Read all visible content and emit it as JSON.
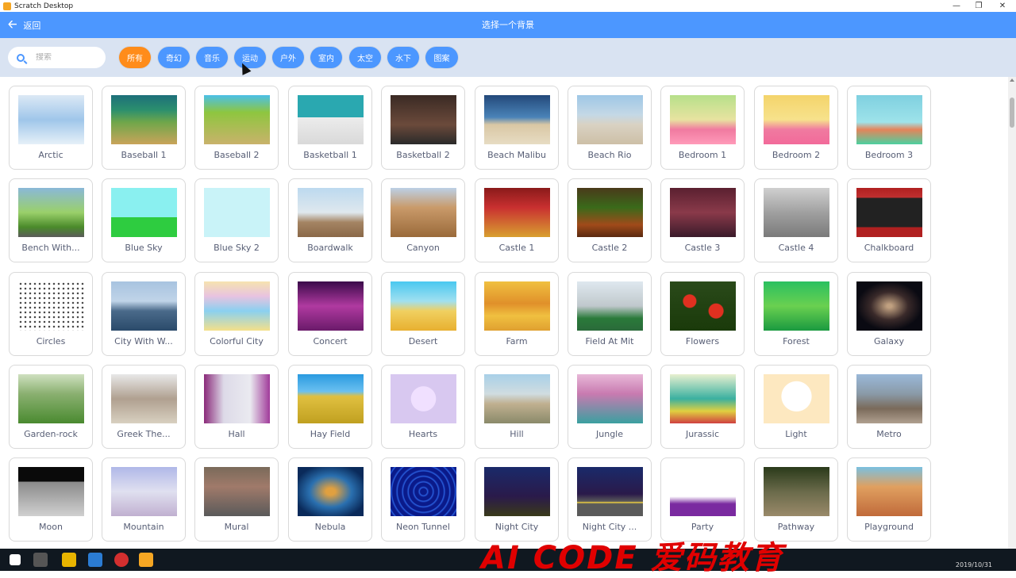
{
  "window": {
    "title": "Scratch Desktop"
  },
  "header": {
    "back_label": "返回",
    "title": "选择一个背景"
  },
  "search": {
    "placeholder": "搜索"
  },
  "tags": [
    "所有",
    "奇幻",
    "音乐",
    "运动",
    "户外",
    "室内",
    "太空",
    "水下",
    "图案"
  ],
  "active_tag": "所有",
  "colors": {
    "header": "#4c97ff",
    "active_tag": "#ff8c1a",
    "tag": "#4c97ff",
    "filterbar": "#d9e3f2"
  },
  "backdrops": [
    {
      "name": "Arctic"
    },
    {
      "name": "Baseball 1"
    },
    {
      "name": "Baseball 2"
    },
    {
      "name": "Basketball 1"
    },
    {
      "name": "Basketball 2"
    },
    {
      "name": "Beach Malibu"
    },
    {
      "name": "Beach Rio"
    },
    {
      "name": "Bedroom 1"
    },
    {
      "name": "Bedroom 2"
    },
    {
      "name": "Bedroom 3"
    },
    {
      "name": "Bench With..."
    },
    {
      "name": "Blue Sky"
    },
    {
      "name": "Blue Sky 2"
    },
    {
      "name": "Boardwalk"
    },
    {
      "name": "Canyon"
    },
    {
      "name": "Castle 1"
    },
    {
      "name": "Castle 2"
    },
    {
      "name": "Castle 3"
    },
    {
      "name": "Castle 4"
    },
    {
      "name": "Chalkboard"
    },
    {
      "name": "Circles"
    },
    {
      "name": "City With W..."
    },
    {
      "name": "Colorful City"
    },
    {
      "name": "Concert"
    },
    {
      "name": "Desert"
    },
    {
      "name": "Farm"
    },
    {
      "name": "Field At Mit"
    },
    {
      "name": "Flowers"
    },
    {
      "name": "Forest"
    },
    {
      "name": "Galaxy"
    },
    {
      "name": "Garden-rock"
    },
    {
      "name": "Greek The..."
    },
    {
      "name": "Hall"
    },
    {
      "name": "Hay Field"
    },
    {
      "name": "Hearts"
    },
    {
      "name": "Hill"
    },
    {
      "name": "Jungle"
    },
    {
      "name": "Jurassic"
    },
    {
      "name": "Light"
    },
    {
      "name": "Metro"
    },
    {
      "name": "Moon"
    },
    {
      "name": "Mountain"
    },
    {
      "name": "Mural"
    },
    {
      "name": "Nebula"
    },
    {
      "name": "Neon Tunnel"
    },
    {
      "name": "Night City"
    },
    {
      "name": "Night City ..."
    },
    {
      "name": "Party"
    },
    {
      "name": "Pathway"
    },
    {
      "name": "Playground"
    }
  ],
  "watermark": "AI CODE 爱码教育",
  "taskbar": {
    "clock": "2019/10/31"
  }
}
